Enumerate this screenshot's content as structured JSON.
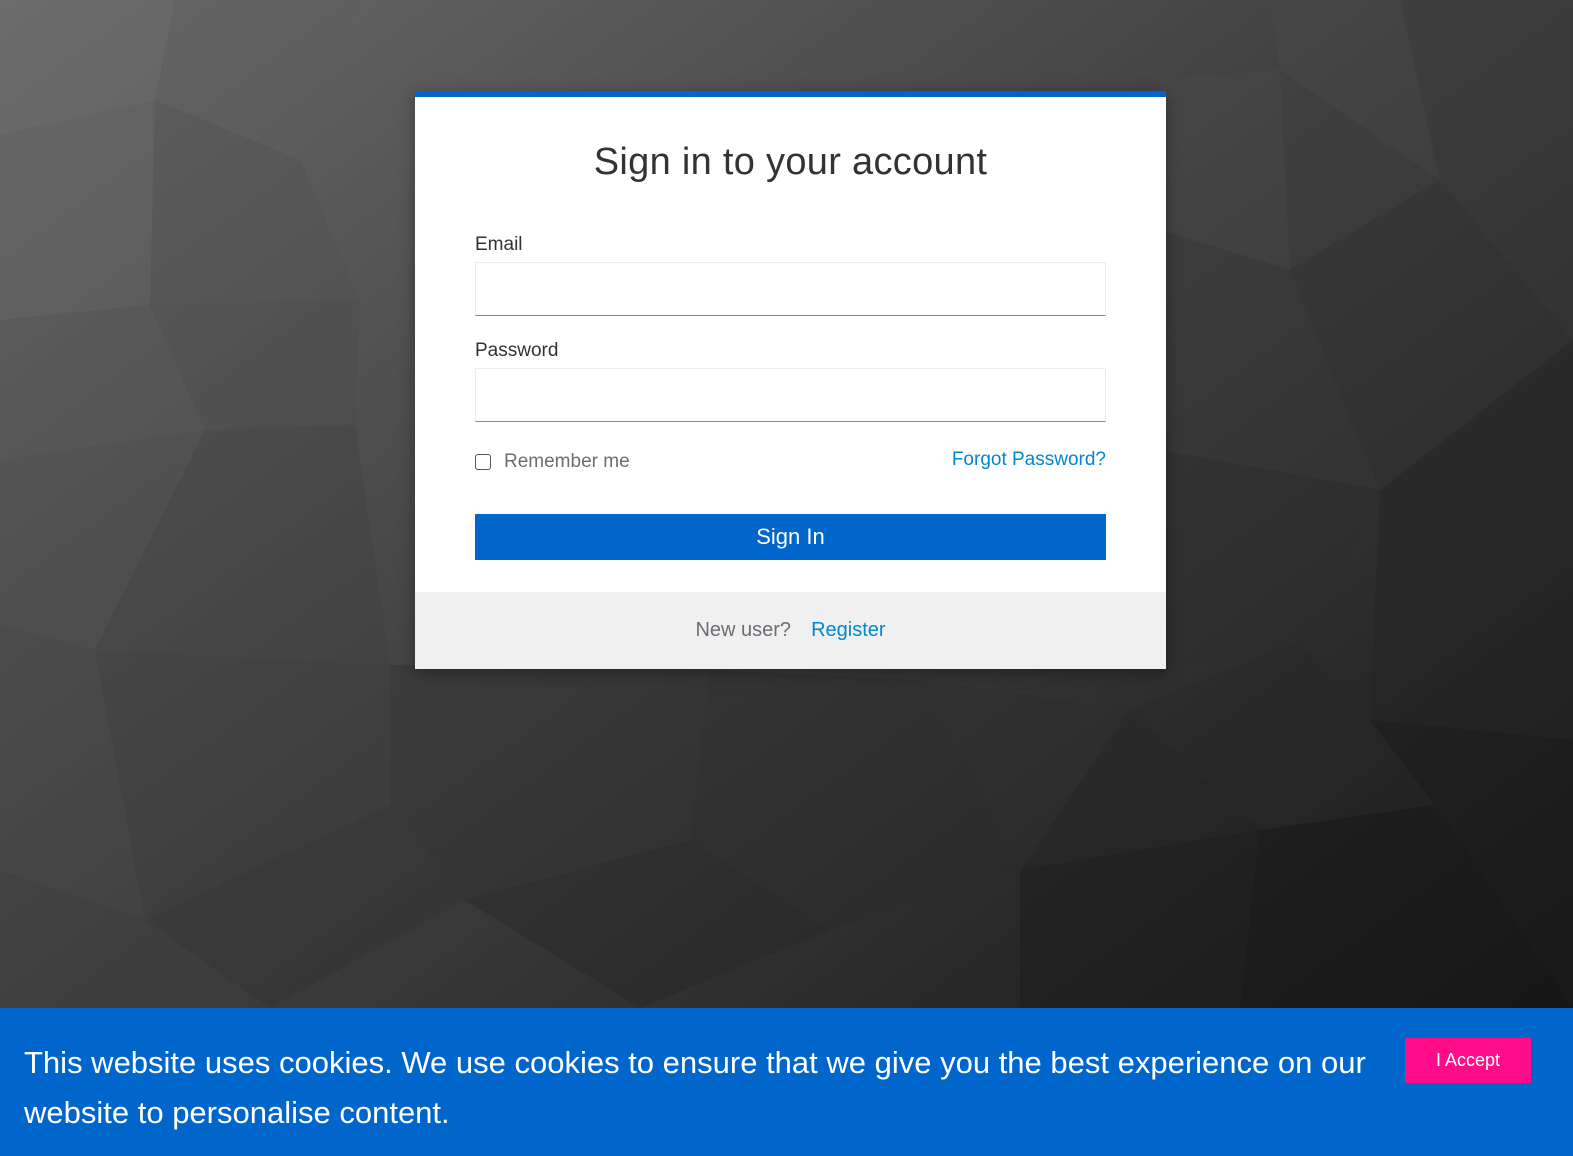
{
  "login": {
    "title": "Sign in to your account",
    "email_label": "Email",
    "email_value": "",
    "password_label": "Password",
    "password_value": "",
    "remember_label": "Remember me",
    "remember_checked": false,
    "forgot_label": "Forgot Password?",
    "submit_label": "Sign In",
    "new_user_text": "New user?",
    "register_label": "Register"
  },
  "cookie": {
    "message": "This website uses cookies. We use cookies to ensure that we give you the best experience on our website to personalise content.",
    "accept_label": "I Accept"
  },
  "colors": {
    "accent": "#0066cc",
    "link": "#0088ce",
    "accept_button": "#ff0c8a",
    "footer_bg": "#f0f0f0"
  }
}
